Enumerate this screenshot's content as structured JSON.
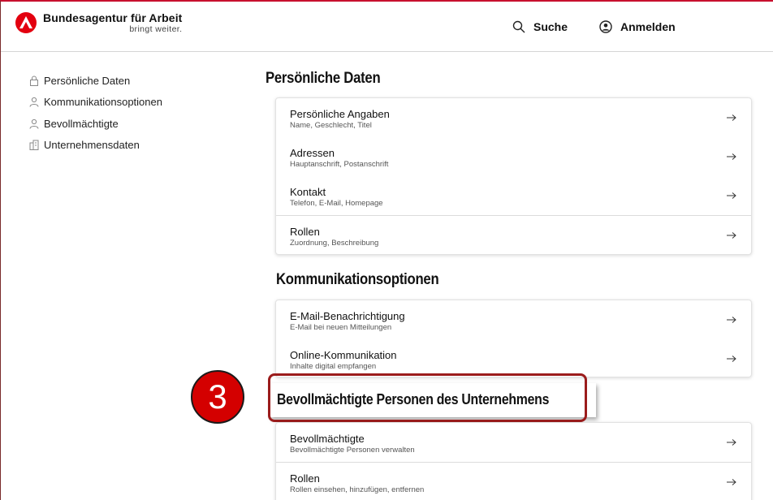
{
  "header": {
    "brand_name": "Bundesagentur für Arbeit",
    "brand_slogan": "bringt weiter.",
    "search_label": "Suche",
    "login_label": "Anmelden"
  },
  "sidebar": {
    "items": [
      {
        "label": "Persönliche Daten",
        "icon": "lock-icon"
      },
      {
        "label": "Kommunikationsoptionen",
        "icon": "person-icon"
      },
      {
        "label": "Bevollmächtigte",
        "icon": "person-icon"
      },
      {
        "label": "Unternehmensdaten",
        "icon": "building-icon"
      }
    ]
  },
  "sections": [
    {
      "title": "Persönliche Daten",
      "rows": [
        {
          "title": "Persönliche Angaben",
          "subtitle": "Name, Geschlecht, Titel"
        },
        {
          "title": "Adressen",
          "subtitle": "Hauptanschrift, Postanschrift"
        },
        {
          "title": "Kontakt",
          "subtitle": "Telefon, E-Mail, Homepage"
        },
        {
          "title": "Rollen",
          "subtitle": "Zuordnung, Beschreibung"
        }
      ]
    },
    {
      "title": "Kommunikationsoptionen",
      "rows": [
        {
          "title": "E-Mail-Benachrichtigung",
          "subtitle": "E-Mail bei neuen Mitteilungen"
        },
        {
          "title": "Online-Kommunikation",
          "subtitle": "Inhalte digital empfangen"
        }
      ]
    },
    {
      "title": "Bevollmächtigte Personen des Unternehmens",
      "rows": [
        {
          "title": "Bevollmächtigte",
          "subtitle": "Bevollmächtigte Personen verwalten"
        },
        {
          "title": "Rollen",
          "subtitle": "Rollen einsehen, hinzufügen, entfernen"
        }
      ]
    }
  ],
  "callout": {
    "number": "3"
  },
  "colors": {
    "brand_red": "#e3000f",
    "callout_red": "#d40000",
    "highlight_border": "#9b1c1c"
  }
}
